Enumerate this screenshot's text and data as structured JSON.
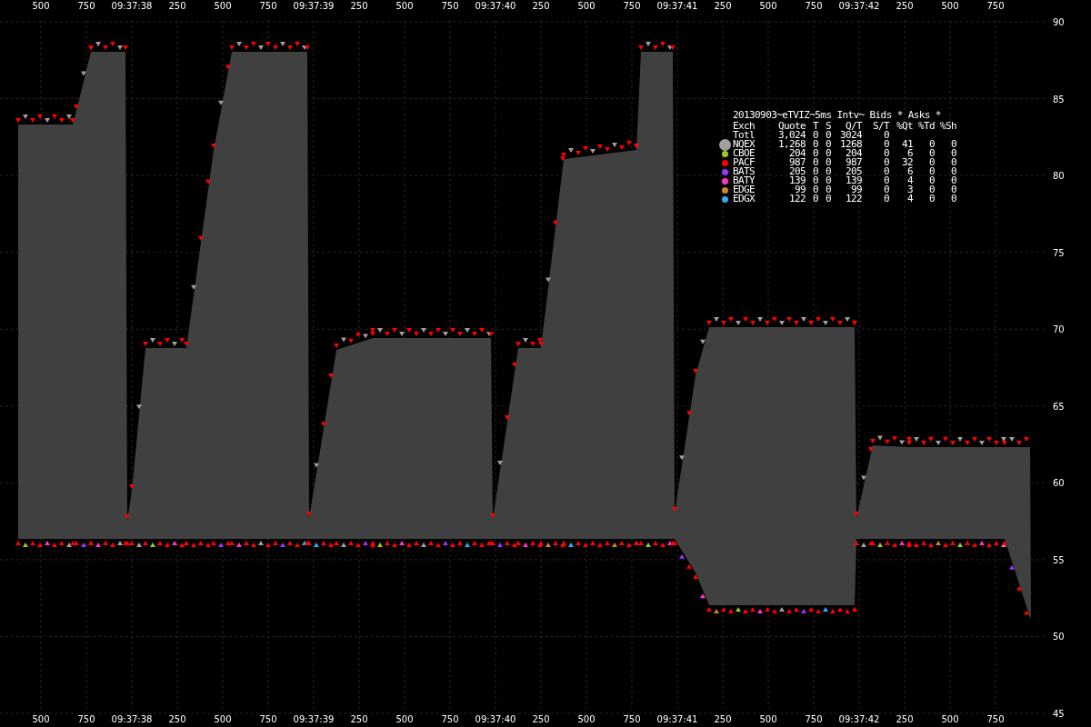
{
  "chart": {
    "top_axis": [
      "500",
      "750",
      "09:37:38",
      "250",
      "500",
      "750",
      "09:37:39",
      "250",
      "500",
      "750",
      "09:37:40",
      "250",
      "500",
      "750",
      "09:37:41",
      "250",
      "500",
      "750",
      "09:37:42",
      "250",
      "500",
      "750"
    ],
    "bottom_axis": [
      "500",
      "750",
      "09:37:38",
      "250",
      "500",
      "750",
      "09:37:39",
      "250",
      "500",
      "750",
      "09:37:40",
      "250",
      "500",
      "750",
      "09:37:41",
      "250",
      "500",
      "750",
      "09:37:42",
      "250",
      "500",
      "750"
    ],
    "right_axis": [
      "90",
      "85",
      "80",
      "75",
      "70",
      "65",
      "60",
      "55",
      "50",
      "45"
    ]
  },
  "legend": {
    "title": "20130903~eTVIZ~5ms Intv~ Bids * Asks *",
    "columns": [
      "Exch",
      "Quote",
      "T",
      "S",
      "Q/T",
      "S/T",
      "%Qt",
      "%Td",
      "%Sh"
    ],
    "rows": [
      {
        "kind": "total",
        "cells": [
          "Totl",
          "3,024",
          "0",
          "0",
          "3024",
          "0"
        ]
      },
      {
        "kind": "exchange",
        "color": "#a0a0a0",
        "cells": [
          "NQEX",
          "1,268",
          "0",
          "0",
          "1268",
          "0",
          "41",
          "0",
          "0"
        ]
      },
      {
        "kind": "exchange",
        "color": "#99cc22",
        "cells": [
          "CBOE",
          "204",
          "0",
          "0",
          "204",
          "0",
          "6",
          "0",
          "0"
        ]
      },
      {
        "kind": "exchange",
        "color": "#ff0000",
        "cells": [
          "PACF",
          "987",
          "0",
          "0",
          "987",
          "0",
          "32",
          "0",
          "0"
        ]
      },
      {
        "kind": "exchange",
        "color": "#9933ff",
        "cells": [
          "BATS",
          "205",
          "0",
          "0",
          "205",
          "0",
          "6",
          "0",
          "0"
        ]
      },
      {
        "kind": "exchange",
        "color": "#ff33cc",
        "cells": [
          "BATY",
          "139",
          "0",
          "0",
          "139",
          "0",
          "4",
          "0",
          "0"
        ]
      },
      {
        "kind": "exchange",
        "color": "#cc8822",
        "cells": [
          "EDGE",
          "99",
          "0",
          "0",
          "99",
          "0",
          "3",
          "0",
          "0"
        ]
      },
      {
        "kind": "exchange",
        "color": "#33aaee",
        "cells": [
          "EDGX",
          "122",
          "0",
          "0",
          "122",
          "0",
          "4",
          "0",
          "0"
        ]
      }
    ]
  }
}
